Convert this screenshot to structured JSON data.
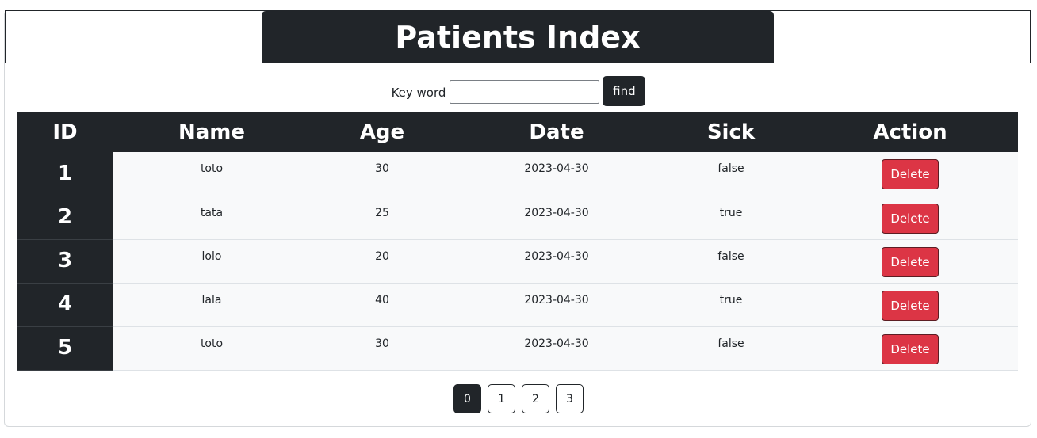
{
  "header": {
    "title": "Patients Index"
  },
  "search": {
    "label": "Key word",
    "value": "",
    "button_label": "find"
  },
  "table": {
    "columns": [
      "ID",
      "Name",
      "Age",
      "Date",
      "Sick",
      "Action"
    ],
    "rows": [
      {
        "id": "1",
        "name": "toto",
        "age": "30",
        "date": "2023-04-30",
        "sick": "false",
        "action": "Delete"
      },
      {
        "id": "2",
        "name": "tata",
        "age": "25",
        "date": "2023-04-30",
        "sick": "true",
        "action": "Delete"
      },
      {
        "id": "3",
        "name": "lolo",
        "age": "20",
        "date": "2023-04-30",
        "sick": "false",
        "action": "Delete"
      },
      {
        "id": "4",
        "name": "lala",
        "age": "40",
        "date": "2023-04-30",
        "sick": "true",
        "action": "Delete"
      },
      {
        "id": "5",
        "name": "toto",
        "age": "30",
        "date": "2023-04-30",
        "sick": "false",
        "action": "Delete"
      }
    ]
  },
  "pagination": {
    "pages": [
      "0",
      "1",
      "2",
      "3"
    ],
    "current": "0"
  },
  "colors": {
    "dark": "#212529",
    "danger": "#dc3545",
    "row_bg": "#f8f9fa"
  }
}
